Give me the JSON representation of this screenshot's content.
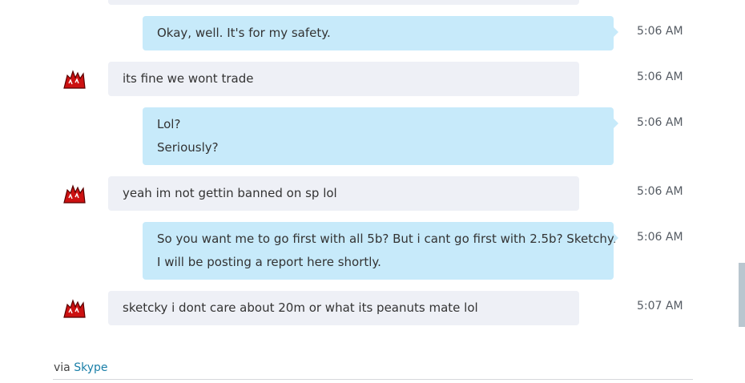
{
  "messages": [
    {
      "direction": "outgoing",
      "lines": [
        "Okay, well. It's for my safety."
      ],
      "time": "5:06 AM"
    },
    {
      "direction": "incoming",
      "lines": [
        "its fine we wont trade"
      ],
      "time": "5:06 AM",
      "avatar": "red-character-avatar"
    },
    {
      "direction": "outgoing",
      "lines": [
        "Lol?",
        "Seriously?"
      ],
      "time": "5:06 AM"
    },
    {
      "direction": "incoming",
      "lines": [
        "yeah im not gettin banned on sp lol"
      ],
      "time": "5:06 AM",
      "avatar": "red-character-avatar"
    },
    {
      "direction": "outgoing",
      "lines": [
        "So you want me to go first with all 5b? But i cant go first with 2.5b? Sketchy.",
        "I will be posting a report here shortly."
      ],
      "time": "5:06 AM"
    },
    {
      "direction": "incoming",
      "lines": [
        "sketcky i dont care about 20m or what its peanuts mate lol"
      ],
      "time": "5:07 AM",
      "avatar": "red-character-avatar"
    }
  ],
  "footer": {
    "prefix": "via",
    "link": "Skype"
  },
  "colors": {
    "outgoing_bubble": "#c7eafa",
    "incoming_bubble": "#eef0f6",
    "link": "#1a7fa8",
    "avatar": "#cc1111"
  }
}
